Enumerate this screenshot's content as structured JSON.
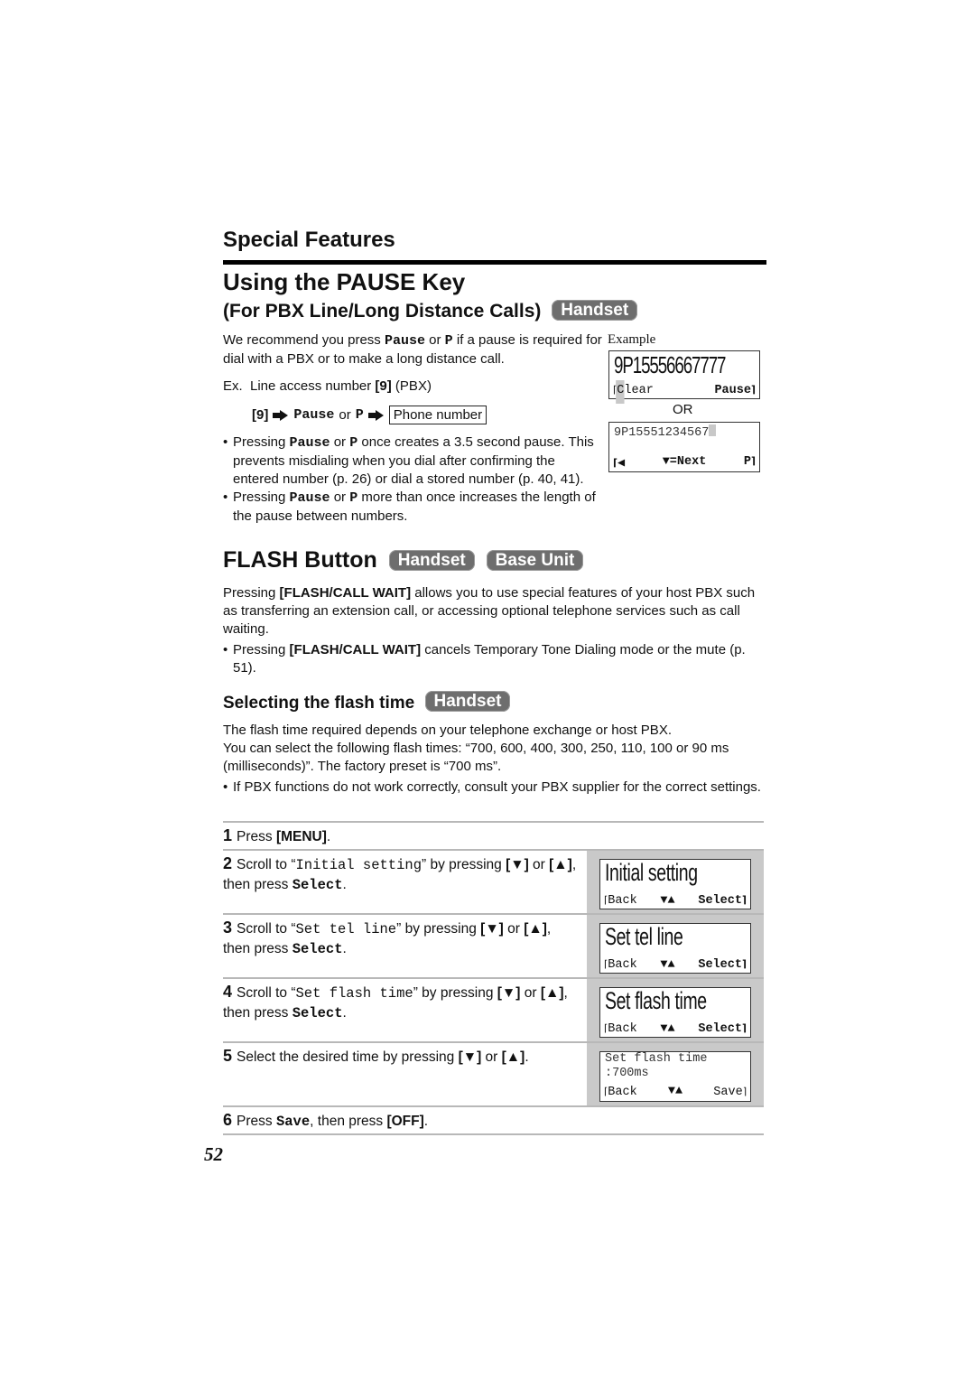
{
  "section_title": "Special Features",
  "pause_key": {
    "title": "Using the PAUSE Key",
    "subtitle": "(For PBX Line/Long Distance Calls)",
    "badge": "Handset",
    "intro": {
      "t1": "We recommend you press ",
      "k1": "Pause",
      "t2": " or ",
      "k2": "P",
      "t3": " if a pause is required for dial with a PBX or to make a long distance call."
    },
    "example_line": {
      "t1": "Ex.  Line access number ",
      "k1": "[9]",
      "t2": " (PBX)"
    },
    "sequence": {
      "key": "[9]",
      "pause": "Pause",
      "or": "or",
      "p": "P",
      "box": "Phone number"
    },
    "bullets": [
      {
        "t1": "Pressing ",
        "k1": "Pause",
        "t2": " or ",
        "k2": "P",
        "t3": " once creates a 3.5 second pause. This prevents misdialing when you dial after confirming the entered number (p. 26) or dial a stored number (p. 40, 41)."
      },
      {
        "t1": "Pressing ",
        "k1": "Pause",
        "t2": " or ",
        "k2": "P",
        "t3": " more than once increases the length of the pause between numbers."
      }
    ],
    "example": {
      "label": "Example",
      "display1": {
        "number": "9P15556667777",
        "left_soft": "Clear",
        "right_soft": "Pause"
      },
      "or": "OR",
      "display2": {
        "number": "9P15551234567",
        "left_soft": "◀",
        "middle_soft": "▼=Next",
        "right_soft": "P"
      }
    }
  },
  "flash": {
    "title": "FLASH Button",
    "badges": [
      "Handset",
      "Base Unit"
    ],
    "para": {
      "t1": "Pressing ",
      "k1": "[FLASH/CALL WAIT]",
      "t2": " allows you to use special features of your host PBX such as transferring an extension call, or accessing optional telephone services such as call waiting."
    },
    "bullet": {
      "t1": "Pressing ",
      "k1": "[FLASH/CALL WAIT]",
      "t2": " cancels Temporary Tone Dialing mode or the mute (p. 51)."
    }
  },
  "flash_time": {
    "title": "Selecting the flash time",
    "badge": "Handset",
    "para1": "The flash time required depends on your telephone exchange or host PBX.",
    "para2": "You can select the following flash times: “700, 600, 400, 300, 250, 110, 100 or 90 ms (milliseconds)”. The factory preset is “700 ms”.",
    "bullet": "If PBX functions do not work correctly, consult your PBX supplier for the correct settings.",
    "steps": [
      {
        "num": "1",
        "t1": "Press ",
        "k1": "[MENU]",
        "t2": "."
      },
      {
        "num": "2",
        "t1": "Scroll to “",
        "m1": "Initial setting",
        "t2": "” by pressing ",
        "k1": "[▼]",
        "t3": " or ",
        "k2": "[▲]",
        "t4": ", then press ",
        "m2": "Select",
        "t5": ".",
        "display": {
          "title": "Initial setting",
          "left": "Back",
          "mid": "▼▲",
          "right": "Select"
        }
      },
      {
        "num": "3",
        "t1": "Scroll to “",
        "m1": "Set tel line",
        "t2": "” by pressing ",
        "k1": "[▼]",
        "t3": " or ",
        "k2": "[▲]",
        "t4": ", then press ",
        "m2": "Select",
        "t5": ".",
        "display": {
          "title": "Set tel line",
          "left": "Back",
          "mid": "▼▲",
          "right": "Select"
        }
      },
      {
        "num": "4",
        "t1": "Scroll to “",
        "m1": "Set flash time",
        "t2": "” by pressing ",
        "k1": "[▼]",
        "t3": " or ",
        "k2": "[▲]",
        "t4": ", then press ",
        "m2": "Select",
        "t5": ".",
        "display": {
          "title": "Set flash time",
          "left": "Back",
          "mid": "▼▲",
          "right": "Select"
        }
      },
      {
        "num": "5",
        "t1": "Select the desired time by pressing ",
        "k1": "[▼]",
        "t2": " or ",
        "k2": "[▲]",
        "t3": ".",
        "display": {
          "line1": "Set flash time",
          "line2": ":700ms",
          "left": "Back",
          "mid": "▼▲",
          "right": "Save"
        }
      },
      {
        "num": "6",
        "t1": "Press ",
        "m1": "Save",
        "t2": ", then press ",
        "k1": "[OFF]",
        "t3": "."
      }
    ]
  },
  "page_number": "52"
}
